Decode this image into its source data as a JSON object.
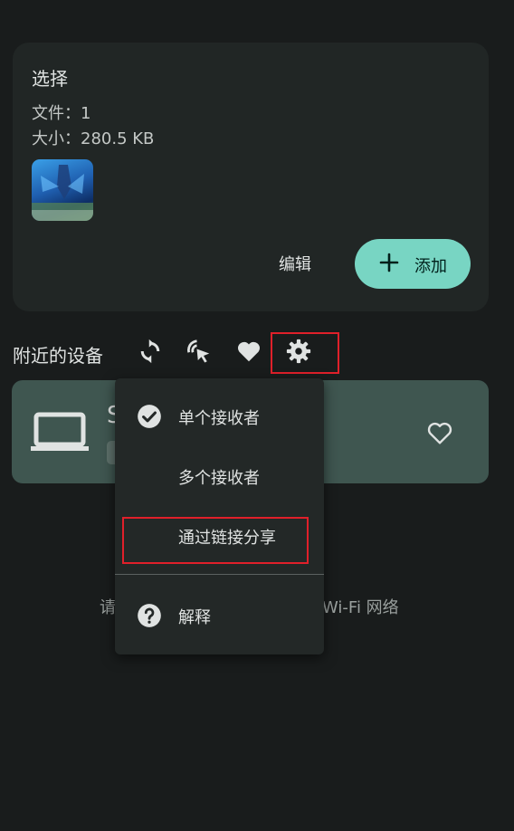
{
  "select_card": {
    "title": "选择",
    "files": "文件：1",
    "size": "大小：280.5 KB",
    "edit_label": "编辑",
    "add_label": "添加"
  },
  "nearby": {
    "label": "附近的设备",
    "icons": [
      "refresh-icon",
      "touch-scan-icon",
      "favorites-icon",
      "settings-icon"
    ]
  },
  "device": {
    "name": "S",
    "icon": "laptop-icon"
  },
  "hint": {
    "left": "请",
    "right": "Wi-Fi 网络"
  },
  "menu": {
    "items": [
      {
        "label": "单个接收者",
        "checked": true
      },
      {
        "label": "多个接收者",
        "checked": false
      },
      {
        "label": "通过链接分享",
        "checked": false
      },
      {
        "label": "解释",
        "icon": "help-icon"
      }
    ]
  },
  "colors": {
    "background": "#191c1c",
    "card": "#212625",
    "accent": "#78d5c3",
    "device_card": "#3f5650",
    "highlight": "#e0202a"
  }
}
